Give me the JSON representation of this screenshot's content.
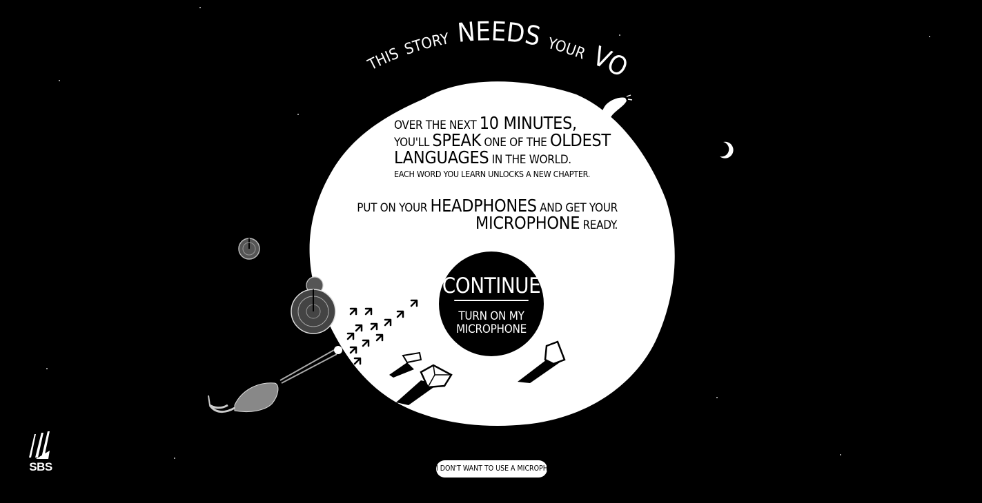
{
  "header": {
    "title_words": [
      "THIS",
      "STORY",
      "NEEDS",
      "YOUR",
      "VOICE."
    ]
  },
  "intro": {
    "line1_pre": "OVER THE NEXT",
    "line1_big": "10 MINUTES,",
    "line2_pre": "YOU'LL",
    "line2_big": "SPEAK",
    "line2_mid": "ONE OF THE",
    "line2_big2": "OLDEST",
    "line3_big": "LANGUAGES",
    "line3_post": "IN THE WORLD."
  },
  "chapter_text": "EACH WORD YOU LEARN UNLOCKS A NEW CHAPTER.",
  "instructions": {
    "line1_pre": "PUT ON YOUR",
    "line1_big": "HEADPHONES",
    "line1_post": "AND GET YOUR",
    "line2_big": "MICROPHONE",
    "line2_post": "READY."
  },
  "cta": {
    "label": "CONTINUE",
    "sublabel_line1": "TURN ON MY",
    "sublabel_line2": "MICROPHONE"
  },
  "no_mic_button": "I DON'T WANT TO USE A MICROPHONE",
  "brand": {
    "logo_text": "SBS"
  },
  "icons": [
    "moon-icon",
    "banana-illustration",
    "lily-pad-icon",
    "crane-bird-illustration",
    "bird-tracks-icon",
    "rock-illustration",
    "sbs-logo"
  ],
  "colors": {
    "background": "#000000",
    "foreground": "#ffffff"
  }
}
